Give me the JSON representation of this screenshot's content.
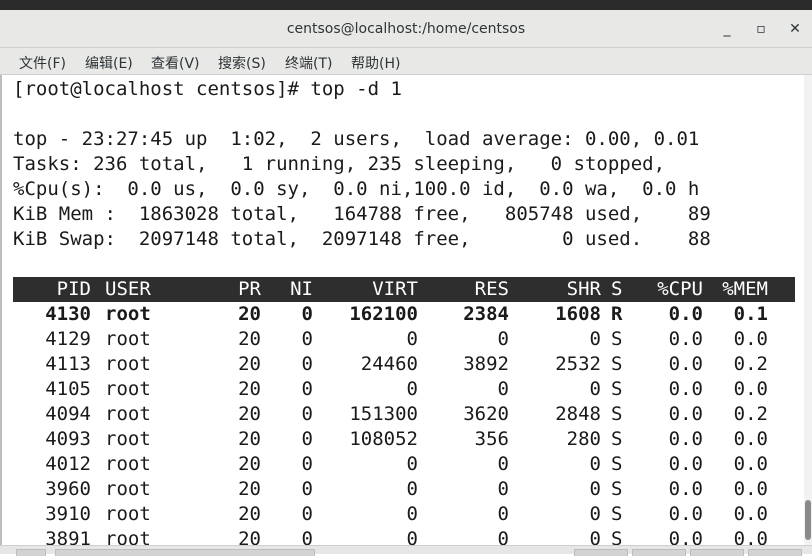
{
  "window": {
    "title": "centsos@localhost:/home/centsos",
    "minimize_glyph": "_",
    "maximize_glyph": "▫",
    "close_glyph": "✕"
  },
  "menu": [
    "文件(F)",
    "编辑(E)",
    "查看(V)",
    "搜索(S)",
    "终端(T)",
    "帮助(H)"
  ],
  "terminal": {
    "prompt_line": "[root@localhost centsos]# top -d 1",
    "summary": [
      "top - 23:27:45 up  1:02,  2 users,  load average: 0.00, 0.01",
      "Tasks: 236 total,   1 running, 235 sleeping,   0 stopped,",
      "%Cpu(s):  0.0 us,  0.0 sy,  0.0 ni,100.0 id,  0.0 wa,  0.0 h",
      "KiB Mem :  1863028 total,   164788 free,   805748 used,    89",
      "KiB Swap:  2097148 total,  2097148 free,        0 used.    88"
    ],
    "columns": [
      "PID",
      "USER",
      "PR",
      "NI",
      "VIRT",
      "RES",
      "SHR",
      "S",
      "%CPU",
      "%MEM"
    ],
    "processes": [
      [
        "4130",
        "root",
        "20",
        "0",
        "162100",
        "2384",
        "1608",
        "R",
        "0.0",
        "0.1"
      ],
      [
        "4129",
        "root",
        "20",
        "0",
        "0",
        "0",
        "0",
        "S",
        "0.0",
        "0.0"
      ],
      [
        "4113",
        "root",
        "20",
        "0",
        "24460",
        "3892",
        "2532",
        "S",
        "0.0",
        "0.2"
      ],
      [
        "4105",
        "root",
        "20",
        "0",
        "0",
        "0",
        "0",
        "S",
        "0.0",
        "0.0"
      ],
      [
        "4094",
        "root",
        "20",
        "0",
        "151300",
        "3620",
        "2848",
        "S",
        "0.0",
        "0.2"
      ],
      [
        "4093",
        "root",
        "20",
        "0",
        "108052",
        "356",
        "280",
        "S",
        "0.0",
        "0.0"
      ],
      [
        "4012",
        "root",
        "20",
        "0",
        "0",
        "0",
        "0",
        "S",
        "0.0",
        "0.0"
      ],
      [
        "3960",
        "root",
        "20",
        "0",
        "0",
        "0",
        "0",
        "S",
        "0.0",
        "0.0"
      ],
      [
        "3910",
        "root",
        "20",
        "0",
        "0",
        "0",
        "0",
        "S",
        "0.0",
        "0.0"
      ],
      [
        "3891",
        "root",
        "20",
        "0",
        "0",
        "0",
        "0",
        "S",
        "0.0",
        "0.0"
      ]
    ]
  },
  "colors": {
    "header_bg": "#2e2e2e",
    "header_fg": "#ffffff",
    "terminal_bg": "#ffffff",
    "chrome_bg": "#e8e8e7"
  }
}
